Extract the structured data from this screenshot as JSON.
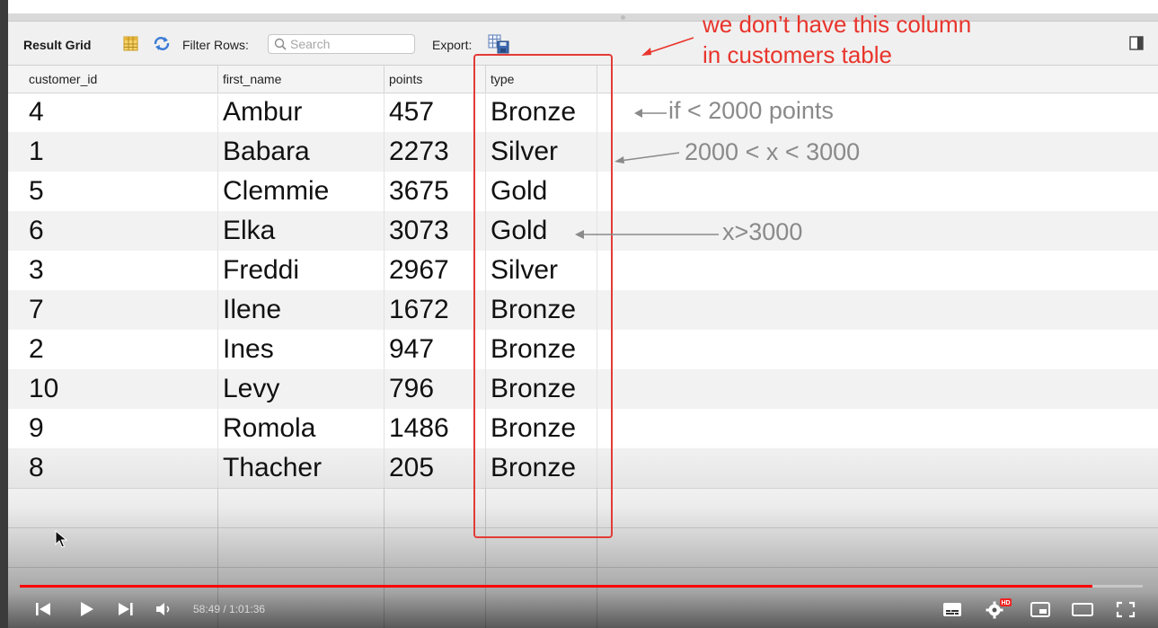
{
  "toolbar": {
    "title": "Result Grid",
    "filter_label": "Filter Rows:",
    "search_placeholder": "Search",
    "export_label": "Export:"
  },
  "grid": {
    "columns": [
      "customer_id",
      "first_name",
      "points",
      "type"
    ],
    "rows": [
      [
        "4",
        "Ambur",
        "457",
        "Bronze"
      ],
      [
        "1",
        "Babara",
        "2273",
        "Silver"
      ],
      [
        "5",
        "Clemmie",
        "3675",
        "Gold"
      ],
      [
        "6",
        "Elka",
        "3073",
        "Gold"
      ],
      [
        "3",
        "Freddi",
        "2967",
        "Silver"
      ],
      [
        "7",
        "Ilene",
        "1672",
        "Bronze"
      ],
      [
        "2",
        "Ines",
        "947",
        "Bronze"
      ],
      [
        "10",
        "Levy",
        "796",
        "Bronze"
      ],
      [
        "9",
        "Romola",
        "1486",
        "Bronze"
      ],
      [
        "8",
        "Thacher",
        "205",
        "Bronze"
      ]
    ]
  },
  "annotations": {
    "note_line1": "we don’t have this column",
    "note_line2": "in customers table",
    "bronze_rule": "if < 2000 points",
    "silver_rule": "2000 < x < 3000",
    "gold_rule": "x>3000",
    "annotation_color": "#e8352c",
    "rule_color": "#8a8a8a"
  },
  "player": {
    "time": "58:49 / 1:01:36",
    "progress": 0.9548,
    "progress_color": "#ff0000",
    "icons": [
      "skip-previous-icon",
      "play-icon",
      "skip-next-icon",
      "volume-icon",
      "subtitles-icon",
      "settings-icon",
      "miniplayer-icon",
      "theater-icon",
      "fullscreen-icon"
    ],
    "quality_badge": "HD"
  }
}
